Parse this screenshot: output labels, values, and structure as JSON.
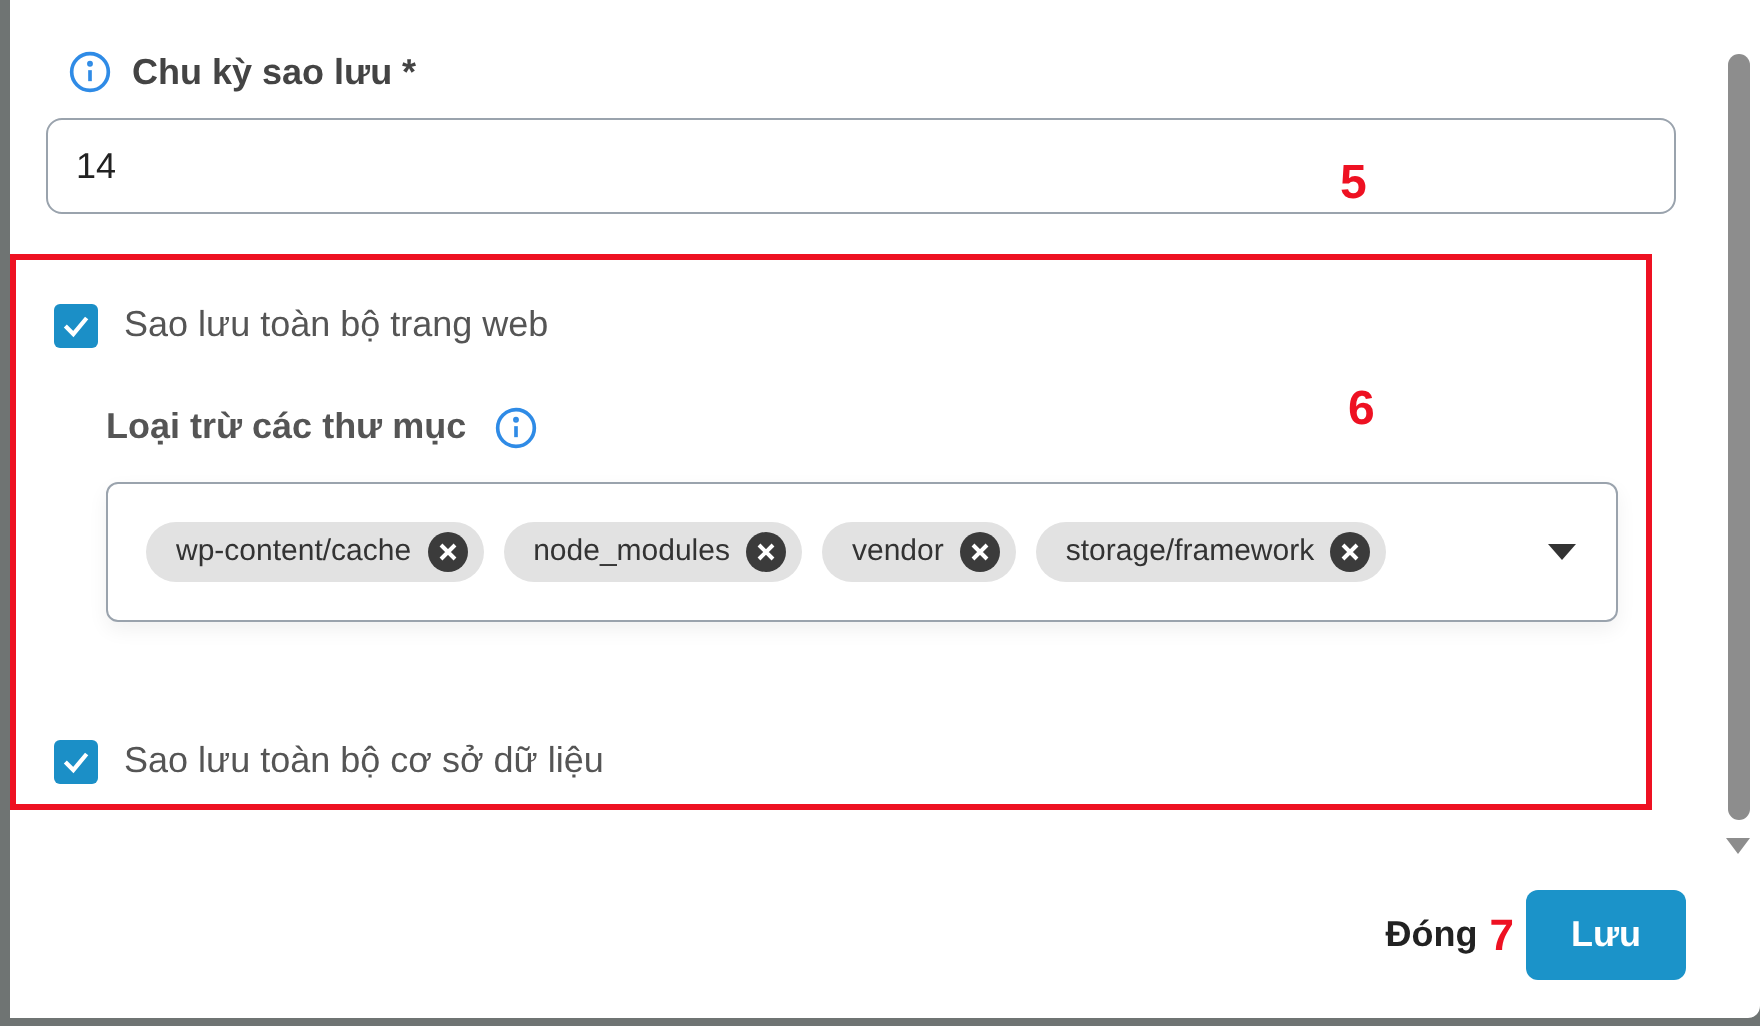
{
  "form": {
    "backup_cycle": {
      "label": "Chu kỳ sao lưu *",
      "value": "14",
      "annotation": "5"
    },
    "full_site": {
      "label": "Sao lưu toàn bộ trang web",
      "checked": true
    },
    "exclude": {
      "label": "Loại trừ các thư mục",
      "annotation": "6",
      "tags": [
        "wp-content/cache",
        "node_modules",
        "vendor",
        "storage/framework"
      ]
    },
    "full_db": {
      "label": "Sao lưu toàn bộ cơ sở dữ liệu",
      "checked": true
    }
  },
  "footer": {
    "close": "Đóng",
    "annotation": "7",
    "save": "Lưu"
  }
}
